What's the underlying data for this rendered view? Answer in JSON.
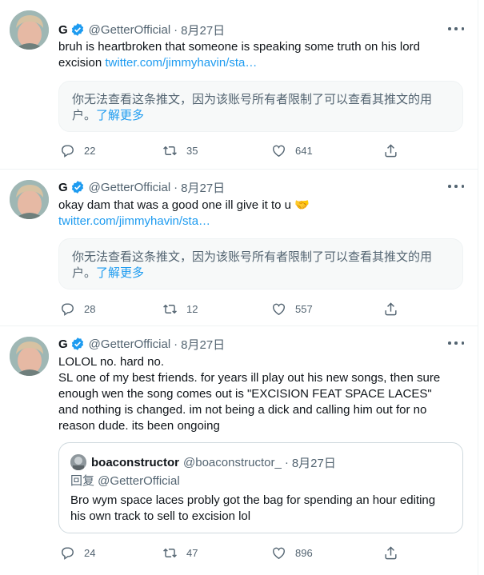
{
  "tweets": [
    {
      "author": {
        "name": "G",
        "handle": "@GetterOfficial"
      },
      "dot": "·",
      "date": "8月27日",
      "text": "bruh is heartbroken that someone is speaking some truth on his lord excision ",
      "link": "twitter.com/jimmyhavin/sta…",
      "unavailable": {
        "text": "你无法查看这条推文，因为该账号所有者限制了可以查看其推文的用户。",
        "learn_more": "了解更多"
      },
      "stats": {
        "replies": "22",
        "retweets": "35",
        "likes": "641"
      }
    },
    {
      "author": {
        "name": "G",
        "handle": "@GetterOfficial"
      },
      "dot": "·",
      "date": "8月27日",
      "text": "okay dam that was a good one ill give it to u 🤝",
      "link": "twitter.com/jimmyhavin/sta…",
      "unavailable": {
        "text": "你无法查看这条推文，因为该账号所有者限制了可以查看其推文的用户。",
        "learn_more": "了解更多"
      },
      "stats": {
        "replies": "28",
        "retweets": "12",
        "likes": "557"
      }
    },
    {
      "author": {
        "name": "G",
        "handle": "@GetterOfficial"
      },
      "dot": "·",
      "date": "8月27日",
      "line1": "LOLOL no. hard no.",
      "text": "SL one of my best friends. for years ill play out his new songs, then sure enough wen the song comes out is \"EXCISION FEAT SPACE LACES\" and nothing is changed. im not being a dick and calling him out for no reason dude. its been ongoing",
      "quote": {
        "name": "boaconstructor",
        "handle": "@boaconstructor_",
        "dot": "·",
        "date": "8月27日",
        "reply_prefix": "回复 ",
        "reply_to": "@GetterOfficial",
        "text": "Bro wym space laces probly got the bag for spending an hour editing his own track to sell to excision lol"
      },
      "stats": {
        "replies": "24",
        "retweets": "47",
        "likes": "896"
      }
    }
  ],
  "icons": {
    "verified": "verified-badge-icon",
    "more": "more-icon",
    "reply": "reply-icon",
    "retweet": "retweet-icon",
    "like": "like-icon",
    "share": "share-icon"
  },
  "colors": {
    "link": "#1d9bf0",
    "secondary": "#536471",
    "text": "#0f1419",
    "verified": "#1d9bf0"
  }
}
